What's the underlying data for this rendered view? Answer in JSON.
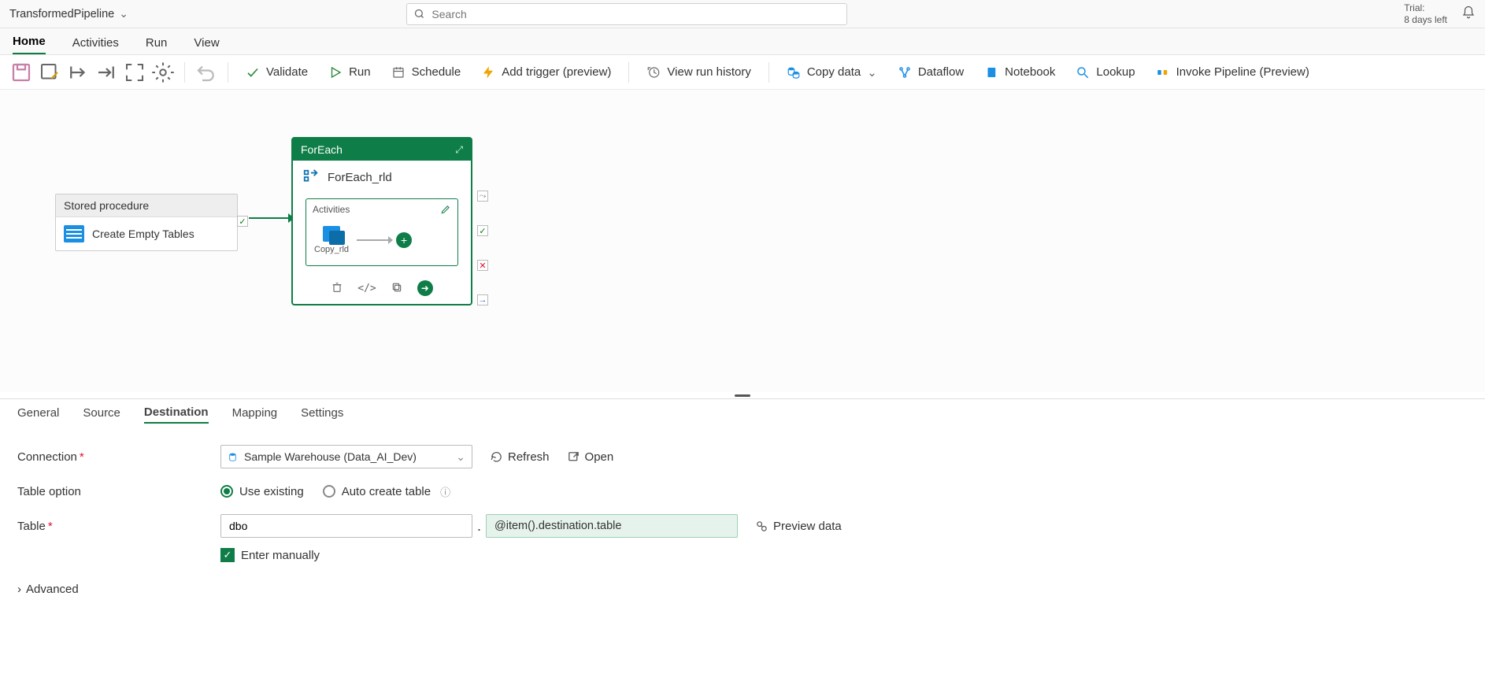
{
  "titlebar": {
    "pipeline_name": "TransformedPipeline",
    "search_placeholder": "Search",
    "trial_label": "Trial:",
    "trial_remaining": "8 days left"
  },
  "menu": {
    "items": [
      "Home",
      "Activities",
      "Run",
      "View"
    ],
    "active": 0
  },
  "ribbon": {
    "validate": "Validate",
    "run": "Run",
    "schedule": "Schedule",
    "add_trigger": "Add trigger (preview)",
    "view_history": "View run history",
    "copy_data": "Copy data",
    "dataflow": "Dataflow",
    "notebook": "Notebook",
    "lookup": "Lookup",
    "invoke": "Invoke Pipeline (Preview)"
  },
  "canvas": {
    "stored_proc": {
      "header": "Stored procedure",
      "name": "Create Empty Tables"
    },
    "foreach": {
      "header": "ForEach",
      "name": "ForEach_rld",
      "activities_label": "Activities",
      "inner_activity": "Copy_rld"
    }
  },
  "panel_tabs": {
    "items": [
      "General",
      "Source",
      "Destination",
      "Mapping",
      "Settings"
    ],
    "active": 2
  },
  "form": {
    "connection_label": "Connection",
    "connection_value": "Sample Warehouse (Data_AI_Dev)",
    "refresh": "Refresh",
    "open": "Open",
    "table_option_label": "Table option",
    "use_existing": "Use existing",
    "auto_create": "Auto create table",
    "table_label": "Table",
    "schema_value": "dbo",
    "table_expr": "@item().destination.table",
    "preview": "Preview data",
    "enter_manually": "Enter manually",
    "advanced": "Advanced"
  }
}
